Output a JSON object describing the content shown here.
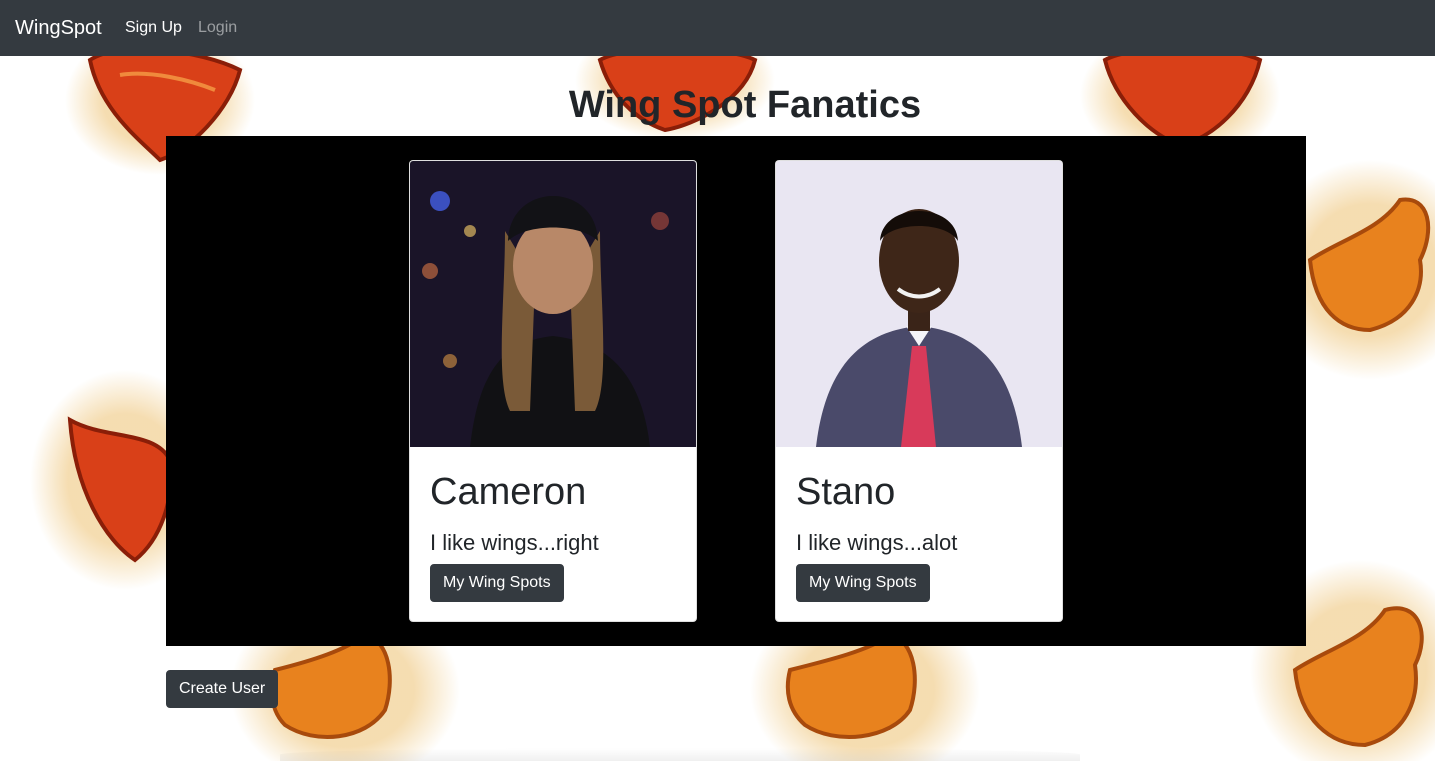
{
  "navbar": {
    "brand": "WingSpot",
    "links": [
      {
        "label": "Sign Up"
      },
      {
        "label": "Login"
      }
    ]
  },
  "page": {
    "title": "Wing Spot Fanatics"
  },
  "users": [
    {
      "name": "Cameron",
      "bio": "I like wings...right",
      "button_label": "My Wing Spots",
      "photo": "portrait-long-hair-beanie-night-city"
    },
    {
      "name": "Stano",
      "bio": "I like wings...alot",
      "button_label": "My Wing Spots",
      "photo": "portrait-man-striped-shirt-red-tie"
    }
  ],
  "actions": {
    "create_user_label": "Create User"
  },
  "colors": {
    "navbar_bg": "#343a40",
    "button_dark": "#343a40",
    "panel_bg": "#000000",
    "wing_orange": "#e8821e",
    "wing_red": "#d8401a"
  }
}
